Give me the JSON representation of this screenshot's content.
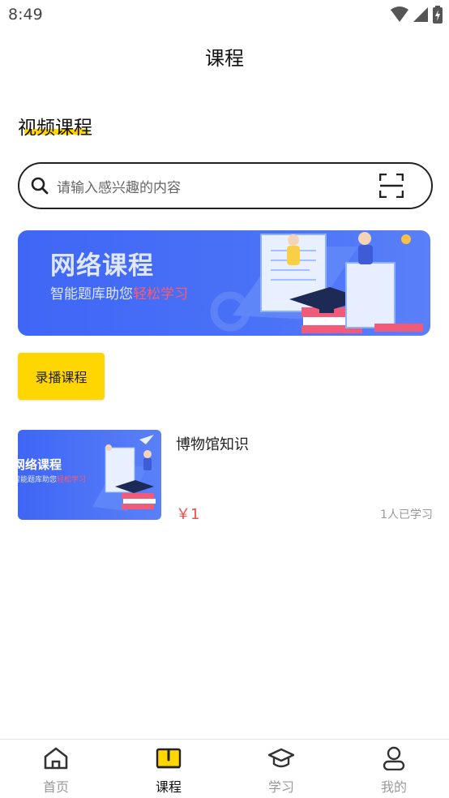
{
  "status_bar": {
    "time": "8:49"
  },
  "header": {
    "title": "课程"
  },
  "section": {
    "title": "视频课程"
  },
  "search": {
    "placeholder": "请输入感兴趣的内容"
  },
  "banner": {
    "title": "网络课程",
    "subtitle_prefix": "智能题库助您",
    "subtitle_highlight": "轻松学习"
  },
  "category_button": {
    "label": "录播课程"
  },
  "courses": [
    {
      "name": "博物馆知识",
      "price": "￥1",
      "learners": "1人已学习",
      "thumb_title": "网络课程",
      "thumb_sub_prefix": "智能题库助您",
      "thumb_sub_highlight": "轻松学习"
    }
  ],
  "tabbar": {
    "items": [
      {
        "label": "首页",
        "icon": "home-icon",
        "active": false
      },
      {
        "label": "课程",
        "icon": "book-icon",
        "active": true
      },
      {
        "label": "学习",
        "icon": "graduation-cap-icon",
        "active": false
      },
      {
        "label": "我的",
        "icon": "user-icon",
        "active": false
      }
    ]
  },
  "colors": {
    "accent": "#ffd600",
    "banner_blue": "#4a72f7",
    "price_red": "#ef4c4c"
  }
}
